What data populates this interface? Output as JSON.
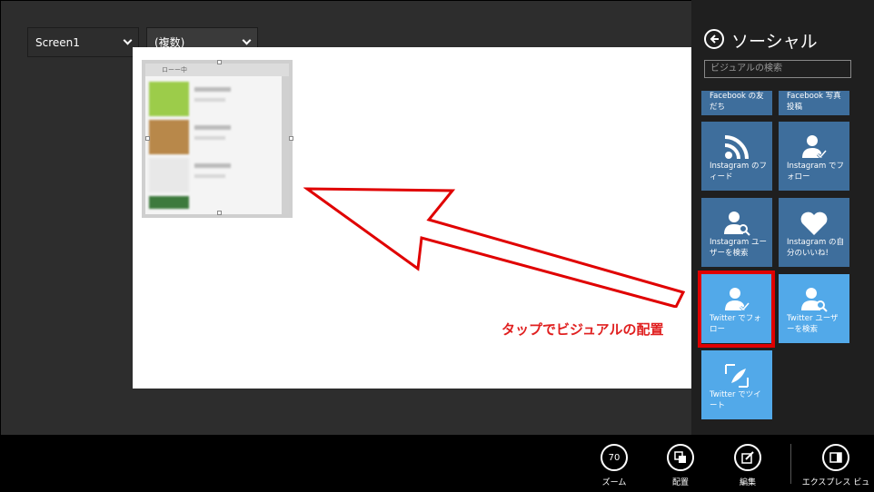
{
  "toolbar": {
    "screen_select": "Screen1",
    "multi_select": "(複数)"
  },
  "canvas": {
    "gallery_header": "ローー中"
  },
  "annotation": {
    "text": "タップでビジュアルの配置",
    "color": "#e02020"
  },
  "panel": {
    "title": "ソーシャル",
    "search_placeholder": "ビジュアルの検索",
    "tiles": [
      {
        "label": "Facebook の友だち",
        "icon": "partial"
      },
      {
        "label": "Facebook 写真投稿",
        "icon": "partial"
      },
      {
        "label": "Instagram のフィード",
        "icon": "rss-icon"
      },
      {
        "label": "Instagram でフォロー",
        "icon": "user-check-icon"
      },
      {
        "label": "Instagram ユーザーを検索",
        "icon": "user-search-icon"
      },
      {
        "label": "Instagram の自分のいいね!",
        "icon": "heart-icon"
      },
      {
        "label": "Twitter でフォロー",
        "icon": "user-check-icon"
      },
      {
        "label": "Twitter ユーザーを検索",
        "icon": "user-search-icon"
      },
      {
        "label": "Twitter でツイート",
        "icon": "tweet-icon"
      }
    ],
    "tile_color": "#3e6e9c",
    "tile_highlight_color": "#52a9e9"
  },
  "appbar": {
    "zoom_value": "70",
    "zoom_label": "ズーム",
    "arrange_label": "配置",
    "edit_label": "編集",
    "express_label": "エクスプレス ビュー"
  }
}
